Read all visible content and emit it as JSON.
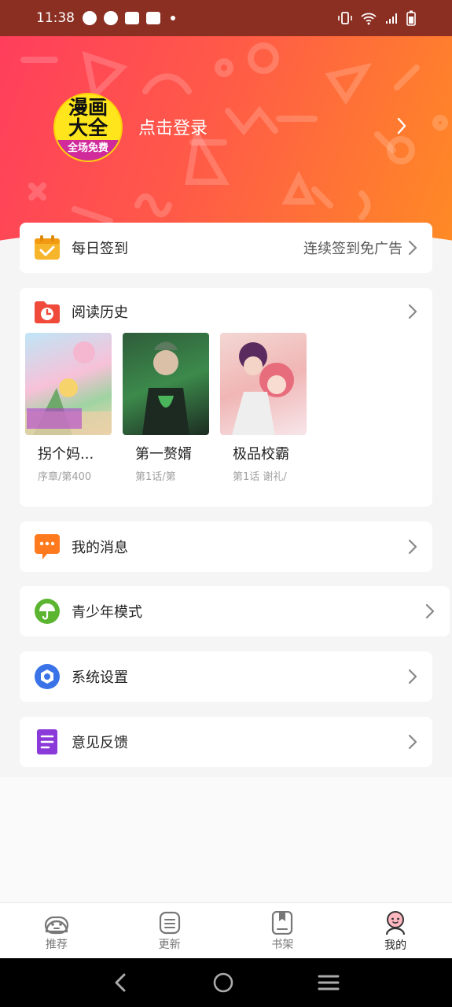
{
  "status_bar": {
    "time": "11:38"
  },
  "header": {
    "logo": {
      "line1": "漫画",
      "line2": "大全",
      "band": "全场免费"
    },
    "login_text": "点击登录"
  },
  "daily_checkin": {
    "label": "每日签到",
    "right_text": "连续签到免广告"
  },
  "history": {
    "label": "阅读历史",
    "books": [
      {
        "title": "拐个妈...",
        "progress": "序章/第400"
      },
      {
        "title": "第一赘婿",
        "progress": "第1话/第"
      },
      {
        "title": "极品校霸",
        "progress": "第1话 谢礼/"
      }
    ]
  },
  "menu": {
    "messages": "我的消息",
    "youth_mode": "青少年模式",
    "settings": "系统设置",
    "feedback": "意见反馈"
  },
  "tabs": [
    {
      "label": "推荐"
    },
    {
      "label": "更新"
    },
    {
      "label": "书架"
    },
    {
      "label": "我的"
    }
  ],
  "colors": {
    "header_start": "#ff3e5c",
    "header_end": "#ff8a25",
    "checkin_icon": "#f7b52c",
    "history_icon": "#ef4a3a",
    "message_icon": "#ff7a1f",
    "youth_icon": "#5cb531",
    "settings_icon": "#3a73e8",
    "feedback_icon": "#8a3ad9"
  },
  "icons": {
    "checkin": "calendar-check-icon",
    "history": "clock-folder-icon",
    "messages": "chat-bubble-icon",
    "youth": "umbrella-icon",
    "settings": "gear-icon",
    "feedback": "document-icon"
  }
}
